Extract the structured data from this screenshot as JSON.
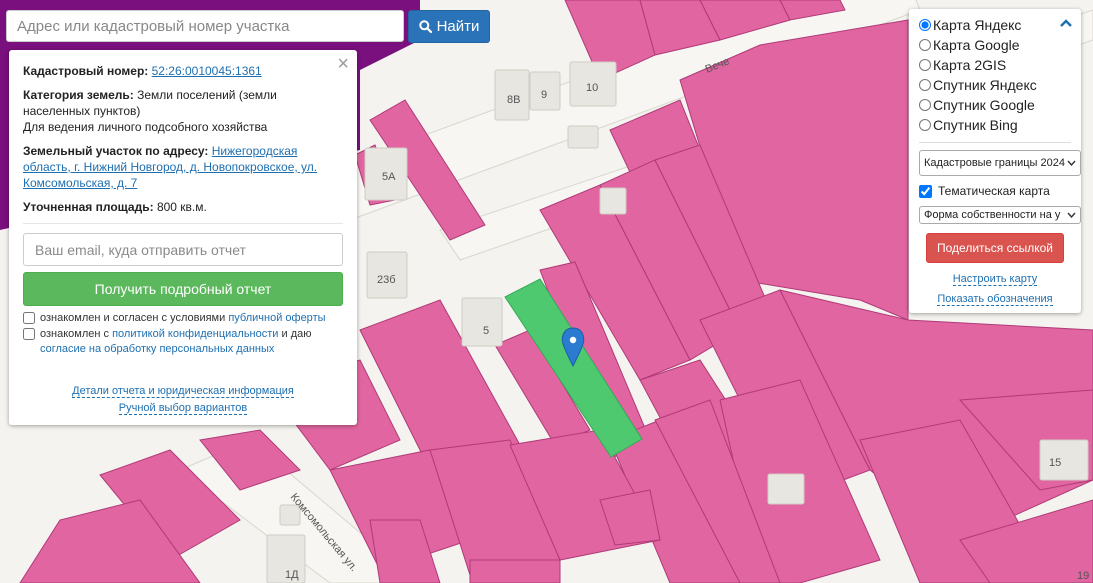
{
  "search": {
    "placeholder": "Адрес или кадастровый номер участка",
    "button_label": "Найти"
  },
  "info": {
    "cadastral_label": "Кадастровый номер:",
    "cadastral_value": "52:26:0010045:1361",
    "category_label": "Категория земель:",
    "category_value": "Земли поселений (земли населенных пунктов)",
    "usage": "Для ведения личного подсобного хозяйства",
    "address_label": "Земельный участок по адресу:",
    "address_value": "Нижегородская область, г. Нижний Новгород, д. Новопокровское, ул. Комсомольская, д. 7",
    "area_label": "Уточненная площадь:",
    "area_value": "800 кв.м.",
    "email_placeholder": "Ваш email, куда отправить отчет",
    "report_button": "Получить подробный отчет",
    "agree1_prefix": "ознакомлен и согласен с условиями",
    "agree1_link": "публичной оферты",
    "agree2_prefix": "ознакомлен с",
    "agree2_link1": "политикой конфиденциальности",
    "agree2_mid": "и даю",
    "agree2_link2": "согласие на обработку персональных данных",
    "details_link": "Детали отчета и юридическая информация",
    "manual_link": "Ручной выбор вариантов"
  },
  "layers": {
    "options": [
      "Карта Яндекс",
      "Карта Google",
      "Карта 2GIS",
      "Спутник Яндекс",
      "Спутник Google",
      "Спутник Bing"
    ],
    "selected_index": 0,
    "boundaries_select": "Кадастровые границы 2024",
    "thematic_label": "Тематическая карта",
    "thematic_checked": true,
    "ownership_select": "Форма собственности на у",
    "share_button": "Поделиться ссылкой",
    "configure_link": "Настроить карту",
    "legend_link": "Показать обозначения"
  },
  "map": {
    "street_labels": [
      "Комсомольская ул.",
      "Вече"
    ],
    "house_numbers": [
      "8В",
      "9",
      "10",
      "5А",
      "23б",
      "5",
      "1Д",
      "15",
      "19"
    ],
    "colors": {
      "parcel": "#e065a0",
      "parcel_border": "#b03a78",
      "selected": "#4fc970",
      "marker": "#2b7bd1",
      "background": "#f4f3ef",
      "purple_zone": "#7a0f7e"
    }
  }
}
